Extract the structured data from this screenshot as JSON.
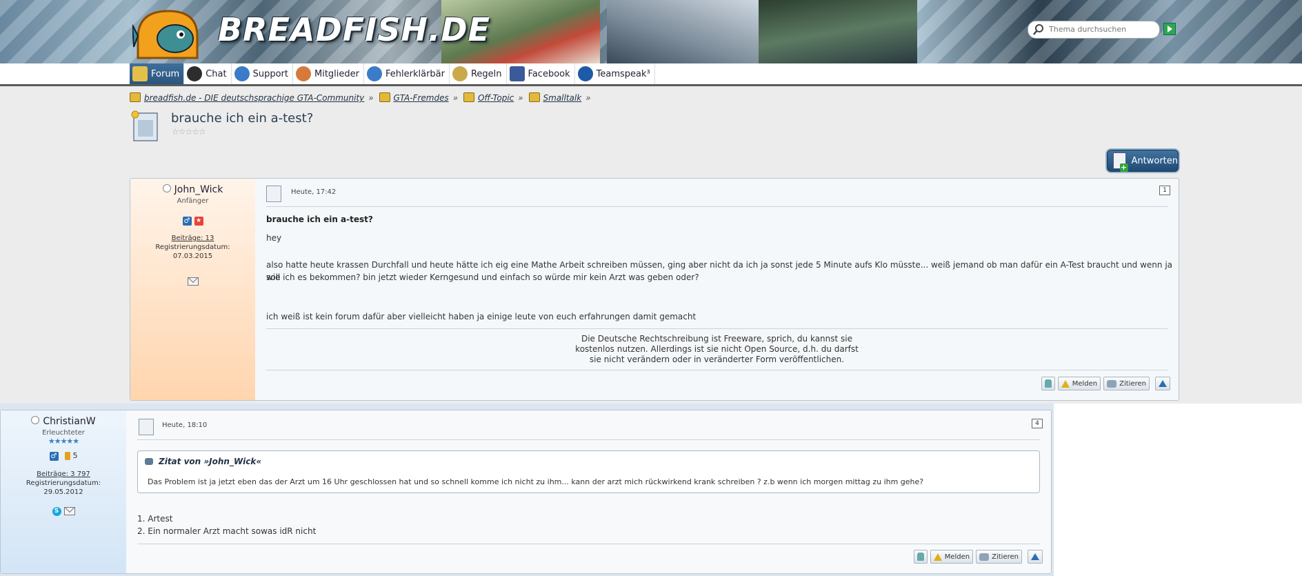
{
  "header": {
    "site_title": "BREADFISH.DE",
    "search_placeholder": "Thema durchsuchen"
  },
  "nav": {
    "items": [
      {
        "label": "Forum",
        "active": true
      },
      {
        "label": "Chat"
      },
      {
        "label": "Support"
      },
      {
        "label": "Mitglieder"
      },
      {
        "label": "Fehlerklärbär"
      },
      {
        "label": "Regeln"
      },
      {
        "label": "Facebook"
      },
      {
        "label": "Teamspeak³"
      }
    ]
  },
  "breadcrumb": [
    "breadfish.de - DIE deutschsprachige GTA-Community",
    "GTA-Fremdes",
    "Off-Topic",
    "Smalltalk"
  ],
  "breadcrumb_sep": "»",
  "thread": {
    "title": "brauche ich ein a-test?",
    "rating": "☆☆☆☆☆",
    "reply_label": "Antworten"
  },
  "posts": [
    {
      "author": "John_Wick",
      "rank": "Anfänger",
      "gender_symbol": "♂",
      "posts_label": "Beiträge: 13",
      "reg_label": "Registrierungsdatum:",
      "reg_date": "07.03.2015",
      "date": "Heute, 17:42",
      "number": "1",
      "heading": "brauche ich ein a-test?",
      "lines": [
        "hey",
        "also hatte heute krassen Durchfall und heute hätte ich eig eine Mathe Arbeit schreiben müssen, ging aber nicht da ich ja sonst jede 5 Minute aufs Klo müsste... weiß jemand ob man dafür ein A-Test braucht und wenn ja wie",
        "soll ich es bekommen? bin jetzt wieder Kerngesund und einfach so würde mir kein Arzt was geben oder?",
        "ich weiß ist kein forum dafür aber vielleicht haben ja einige leute von euch erfahrungen damit gemacht"
      ],
      "signature": [
        "Die Deutsche Rechtschreibung ist Freeware, sprich, du kannst sie",
        "kostenlos nutzen. Allerdings ist sie nicht Open Source, d.h. du darfst",
        "sie nicht verändern oder in veränderter Form veröffentlichen."
      ],
      "buttons": {
        "report": "Melden",
        "quote": "Zitieren"
      }
    },
    {
      "author": "ChristianW",
      "rank": "Erleuchteter",
      "rank_stars": "★★★★★",
      "gender_symbol": "♂",
      "trophy_count": "5",
      "posts_label": "Beiträge: 3 797",
      "reg_label": "Registrierungsdatum:",
      "reg_date": "29.05.2012",
      "date": "Heute, 18:10",
      "number": "4",
      "quote_title": "Zitat von »John_Wick«",
      "quote_text": "Das Problem ist ja jetzt eben das der Arzt um 16 Uhr geschlossen hat und so schnell komme ich nicht zu ihm... kann der arzt mich rückwirkend krank schreiben ? z.b wenn ich morgen mittag zu ihm gehe?",
      "lines": [
        "1. Artest",
        "2. Ein normaler Arzt macht sowas idR nicht"
      ],
      "buttons": {
        "report": "Melden",
        "quote": "Zitieren"
      }
    }
  ],
  "colors": {
    "nav_active": "#2b557e",
    "sidebar_post1": "#ffdcb8",
    "sidebar_post2": "#d6e6f6"
  }
}
